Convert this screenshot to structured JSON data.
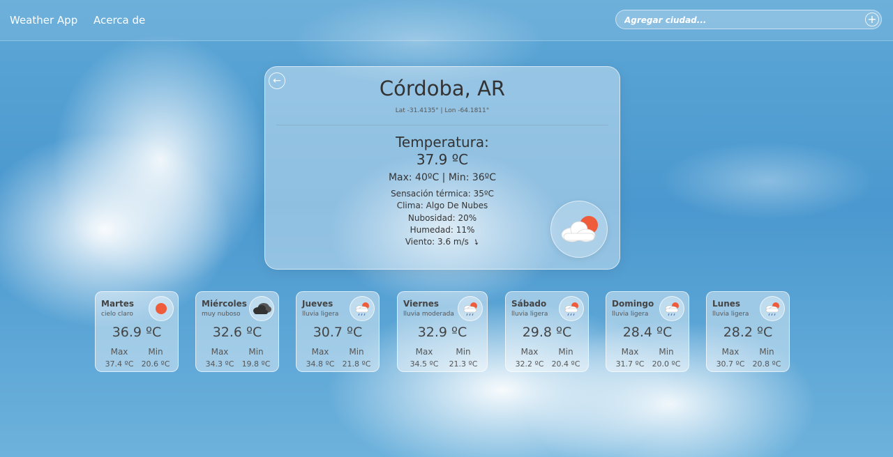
{
  "nav": {
    "brand": "Weather App",
    "about": "Acerca de"
  },
  "search": {
    "placeholder": "Agregar ciudad..."
  },
  "main": {
    "city": "Córdoba, AR",
    "coords": "Lat -31.4135° | Lon -64.1811°",
    "temp_label": "Temperatura:",
    "temp_value": "37.9 ºC",
    "max_min": "Max: 40ºC | Min: 36ºC",
    "feels_like": "Sensación térmica: 35ºC",
    "weather": "Clima: Algo De Nubes",
    "clouds": "Nubosidad: 20%",
    "humidity": "Humedad: 11%",
    "wind": "Viento: 3.6 m/s",
    "icon": "partly-cloudy-icon"
  },
  "forecast_labels": {
    "max": "Max",
    "min": "Min"
  },
  "forecast": [
    {
      "day": "Martes",
      "desc": "cielo claro",
      "temp": "36.9 ºC",
      "max": "37.4 ºC",
      "min": "20.6 ºC",
      "icon": "sun-icon"
    },
    {
      "day": "Miércoles",
      "desc": "muy nuboso",
      "temp": "32.6 ºC",
      "max": "34.3 ºC",
      "min": "19.8 ºC",
      "icon": "broken-clouds-icon"
    },
    {
      "day": "Jueves",
      "desc": "lluvia ligera",
      "temp": "30.7 ºC",
      "max": "34.8 ºC",
      "min": "21.8 ºC",
      "icon": "rain-icon"
    },
    {
      "day": "Viernes",
      "desc": "lluvia moderada",
      "temp": "32.9 ºC",
      "max": "34.5 ºC",
      "min": "21.3 ºC",
      "icon": "rain-icon"
    },
    {
      "day": "Sábado",
      "desc": "lluvia ligera",
      "temp": "29.8 ºC",
      "max": "32.2 ºC",
      "min": "20.4 ºC",
      "icon": "rain-icon"
    },
    {
      "day": "Domingo",
      "desc": "lluvia ligera",
      "temp": "28.4 ºC",
      "max": "31.7 ºC",
      "min": "20.0 ºC",
      "icon": "rain-icon"
    },
    {
      "day": "Lunes",
      "desc": "lluvia ligera",
      "temp": "28.2 ºC",
      "max": "30.7 ºC",
      "min": "20.8 ºC",
      "icon": "rain-icon"
    }
  ],
  "colors": {
    "sun": "#ee5c3b",
    "cloud": "#ffffff",
    "dark_cloud": "#444444",
    "rain": "#5a7fb0"
  }
}
